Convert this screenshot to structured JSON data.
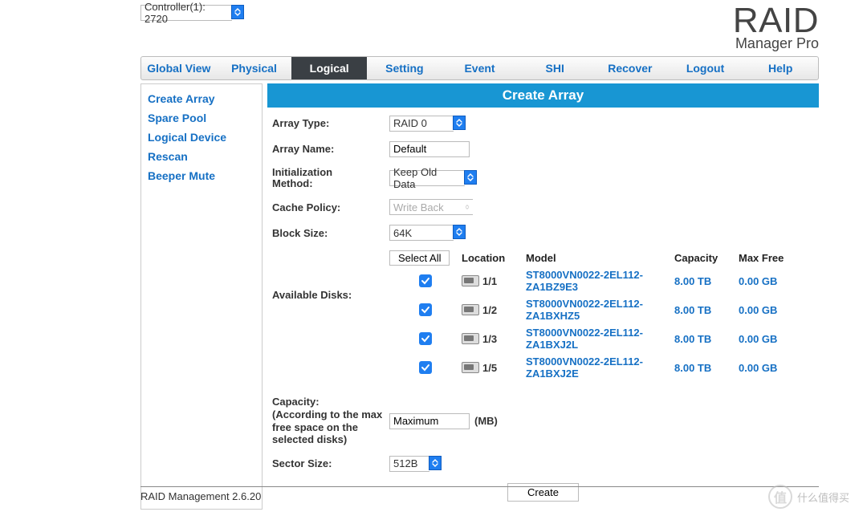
{
  "controller": {
    "label": "Controller(1): 2720"
  },
  "logo": {
    "line1": "RAID",
    "line2": "Manager Pro"
  },
  "tabs": [
    "Global View",
    "Physical",
    "Logical",
    "Setting",
    "Event",
    "SHI",
    "Recover",
    "Logout",
    "Help"
  ],
  "active_tab": "Logical",
  "sidebar": [
    "Create Array",
    "Spare Pool",
    "Logical Device",
    "Rescan",
    "Beeper Mute"
  ],
  "panel_title": "Create Array",
  "form": {
    "array_type": {
      "label": "Array Type:",
      "value": "RAID 0"
    },
    "array_name": {
      "label": "Array Name:",
      "value": "Default"
    },
    "init_method": {
      "label": "Initialization Method:",
      "value": "Keep Old Data"
    },
    "cache_policy": {
      "label": "Cache Policy:",
      "value": "Write Back"
    },
    "block_size": {
      "label": "Block Size:",
      "value": "64K"
    },
    "available_disks": {
      "label": "Available Disks:"
    },
    "select_all": "Select All",
    "headers": {
      "location": "Location",
      "model": "Model",
      "capacity": "Capacity",
      "maxfree": "Max Free"
    },
    "capacity": {
      "label": "Capacity:\n(According to the max free space on the selected disks)",
      "value": "Maximum",
      "unit": "(MB)"
    },
    "sector_size": {
      "label": "Sector Size:",
      "value": "512B"
    },
    "create_button": "Create"
  },
  "disks": [
    {
      "location": "1/1",
      "model": "ST8000VN0022-2EL112-ZA1BZ9E3",
      "capacity": "8.00 TB",
      "maxfree": "0.00 GB"
    },
    {
      "location": "1/2",
      "model": "ST8000VN0022-2EL112-ZA1BXHZ5",
      "capacity": "8.00 TB",
      "maxfree": "0.00 GB"
    },
    {
      "location": "1/3",
      "model": "ST8000VN0022-2EL112-ZA1BXJ2L",
      "capacity": "8.00 TB",
      "maxfree": "0.00 GB"
    },
    {
      "location": "1/5",
      "model": "ST8000VN0022-2EL112-ZA1BXJ2E",
      "capacity": "8.00 TB",
      "maxfree": "0.00 GB"
    }
  ],
  "footer": "RAID Management 2.6.20",
  "watermark": {
    "icon": "值",
    "text": "什么值得买"
  }
}
